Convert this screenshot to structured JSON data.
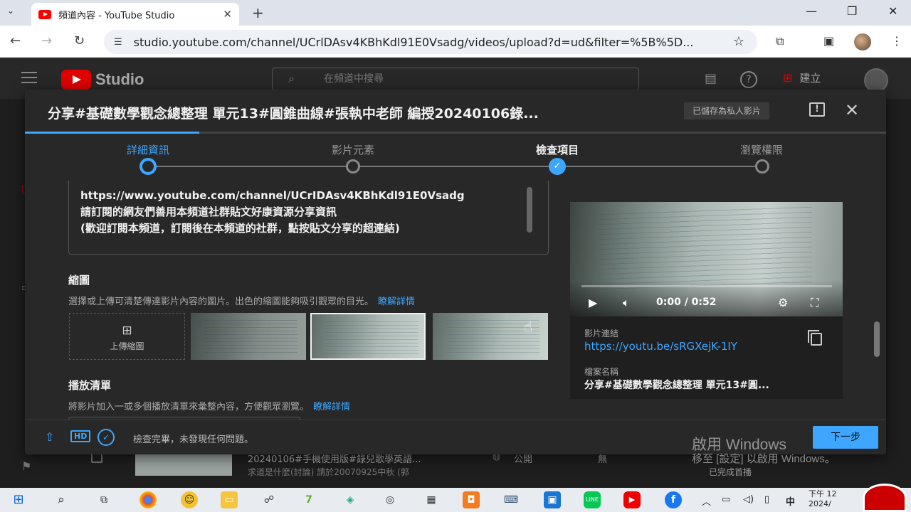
{
  "browser": {
    "tab_title": "頻道內容 - YouTube Studio",
    "url": "studio.youtube.com/channel/UCrlDAsv4KBhKdl91E0Vsadg/videos/upload?d=ud&filter=%5B%5D..."
  },
  "studio": {
    "logo_text": "Studio",
    "search_placeholder": "在頻道中搜尋",
    "create_label": "建立"
  },
  "modal": {
    "title": "分享#基礎數學觀念總整理 單元13#圓錐曲線#張執中老師 編授20240106錄...",
    "saved_badge": "已儲存為私人影片",
    "steps": [
      {
        "label": "詳細資訊",
        "state": "current"
      },
      {
        "label": "影片元素",
        "state": "todo"
      },
      {
        "label": "檢查項目",
        "state": "done"
      },
      {
        "label": "瀏覽權限",
        "state": "todo"
      }
    ],
    "description_lines": [
      "https://www.youtube.com/channel/UCrIDAsv4KBhKdl91E0Vsadg",
      "請訂閱的網友們善用本頻道社群貼文好康資源分享資訊",
      "(歡迎訂閱本頻道，訂閱後在本頻道的社群，點按貼文分享的超連結)"
    ],
    "thumbnail": {
      "title": "縮圖",
      "subtitle": "選擇或上傳可清楚傳達影片內容的圖片。出色的縮圖能夠吸引觀眾的目光。",
      "link": "瞭解詳情",
      "upload_label": "上傳縮圖"
    },
    "playlist": {
      "title": "播放清單",
      "subtitle": "將影片加入一或多個播放清單來彙整內容，方便觀眾瀏覽。",
      "link": "瞭解詳情"
    },
    "preview": {
      "time": "0:00 / 0:52",
      "link_label": "影片連結",
      "link_url": "https://youtu.be/sRGXejK-1IY",
      "filename_label": "檔案名稱",
      "filename": "分享#基礎數學觀念總整理 單元13#圓..."
    },
    "footer": {
      "hd_badge": "HD",
      "status": "檢查完畢，未發現任何問題。",
      "next_label": "下一步"
    }
  },
  "background": {
    "row_title": "20240106#手機使用版#錄兒歌學英語...",
    "row_desc": "求道是什麼(討論) 請於20070925中秋 (郭",
    "row_visibility": "公開",
    "row_none": "無",
    "row_status": "已完成首播"
  },
  "watermark": {
    "line1": "啟用 Windows",
    "line2": "移至 [設定] 以啟用 Windows。"
  },
  "taskbar": {
    "ime": "中",
    "clock_line1": "下午 12",
    "clock_line2": "2024/"
  }
}
